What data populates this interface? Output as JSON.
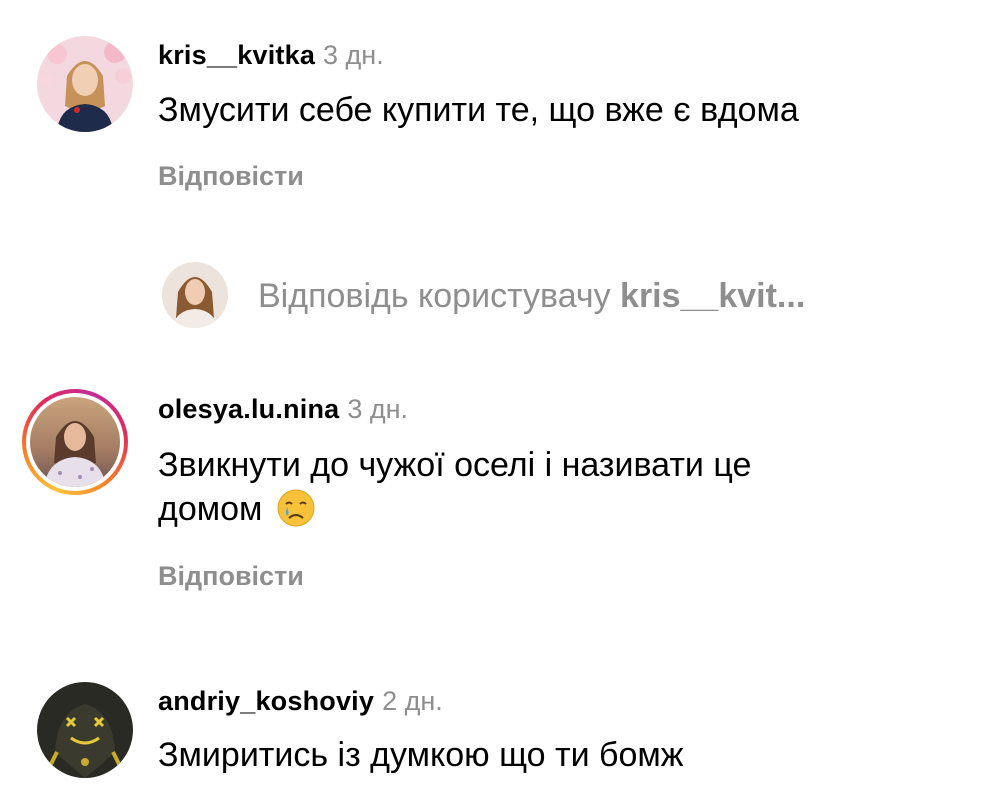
{
  "comments": [
    {
      "username": "kris__kvitka",
      "time": "3 дн.",
      "text": "Змусити себе купити те, що вже є вдома",
      "reply_label": "Відповісти"
    },
    {
      "username": "olesya.lu.nina",
      "time": "3 дн.",
      "text_line1": "Звикнути до чужої оселі і називати це",
      "text_line2": "домом",
      "emoji": "crying-face",
      "reply_label": "Відповісти"
    },
    {
      "username": "andriy_koshoviy",
      "time": "2 дн.",
      "text": "Змиритись із думкою що ти бомж"
    }
  ],
  "replies": {
    "prefix": "Відповідь користувачу ",
    "user": "kris__kvit..."
  },
  "colors": {
    "secondary_text": "#8e8e8e",
    "primary_text": "#000000",
    "story_ring_start": "#f9c33a",
    "story_ring_end": "#c12d97"
  },
  "icons": {
    "emoji": "crying-face-icon"
  }
}
